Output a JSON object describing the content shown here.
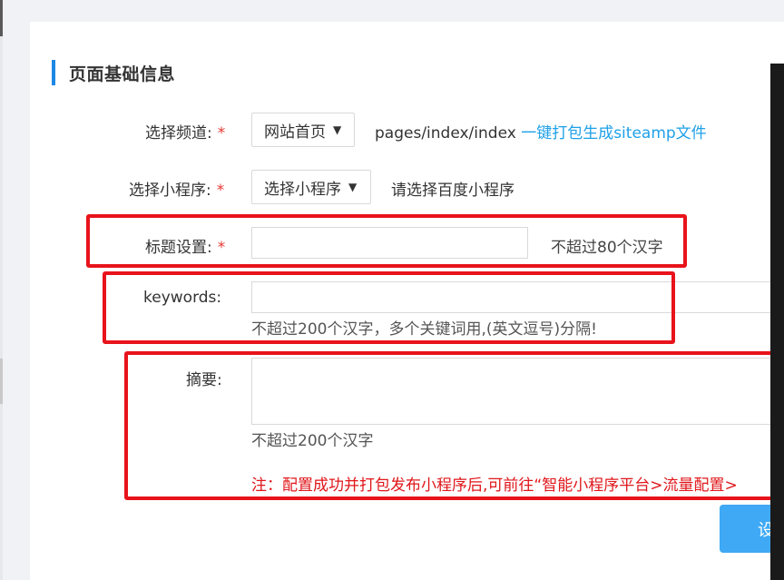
{
  "section": {
    "title": "页面基础信息"
  },
  "form": {
    "channel": {
      "label": "选择频道:",
      "required_mark": "*",
      "selected": "网站首页",
      "path": "pages/index/index",
      "link": "一键打包生成siteamp文件"
    },
    "miniprogram": {
      "label": "选择小程序:",
      "required_mark": "*",
      "selected": "选择小程序",
      "hint": "请选择百度小程序"
    },
    "title": {
      "label": "标题设置:",
      "required_mark": "*",
      "value": "",
      "hint": "不超过80个汉字"
    },
    "keywords": {
      "label": "keywords:",
      "value": "",
      "hint": "不超过200个汉字，多个关键词用,(英文逗号)分隔!"
    },
    "summary": {
      "label": "摘要:",
      "value": "",
      "hint": "不超过200个汉字",
      "note": "注：配置成功并打包发布小程序后,可前往“智能小程序平台>流量配置>"
    },
    "submit_label": "设"
  },
  "icons": {
    "caret": "caret-down-icon"
  },
  "colors": {
    "accent": "#1e88e5",
    "link": "#1ea0e8",
    "required": "#e53935",
    "highlight": "#e8131b",
    "button": "#3fa9f5"
  }
}
